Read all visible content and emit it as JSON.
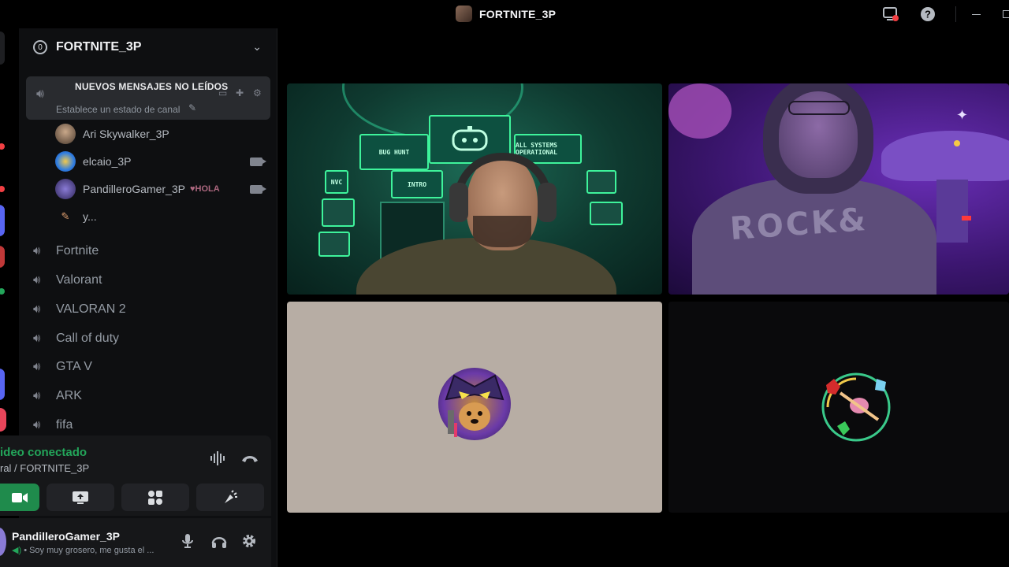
{
  "window": {
    "title": "FORTNITE_3P"
  },
  "server": {
    "name": "FORTNITE_3P",
    "icon_label": "0"
  },
  "banner": {
    "text": "NUEVOS MENSAJES NO LEÍDOS",
    "channel_status": "Establece un estado de canal"
  },
  "voice_users": [
    {
      "name": "Ari Skywalker_3P",
      "tag": ""
    },
    {
      "name": "elcaio_3P",
      "tag": ""
    },
    {
      "name": "PandilleroGamer_3P",
      "tag": "♥HOLA"
    },
    {
      "name": "y...",
      "tag": ""
    }
  ],
  "channels": [
    {
      "name": "Fortnite"
    },
    {
      "name": "Valorant"
    },
    {
      "name": "VALORAN 2"
    },
    {
      "name": "Call of duty"
    },
    {
      "name": "GTA V"
    },
    {
      "name": "ARK"
    },
    {
      "name": "fifa"
    }
  ],
  "voice_panel": {
    "status": "ideo conectado",
    "channel": "ral / FORTNITE_3P"
  },
  "user_panel": {
    "name": "PandilleroGamer_3P",
    "status": "• Soy muy grosero, me gusta el ..."
  },
  "scene": {
    "screen_labels": [
      "BUG",
      "HUNT",
      "ALL SYSTEMS OPERATIONAL",
      "NVC",
      "INTRO"
    ],
    "shirt_text": "ROCK&"
  },
  "colors": {
    "connected_green": "#23a55a",
    "sidebar_bg": "#0e0f11",
    "tile3_bg": "#b7ada4"
  }
}
